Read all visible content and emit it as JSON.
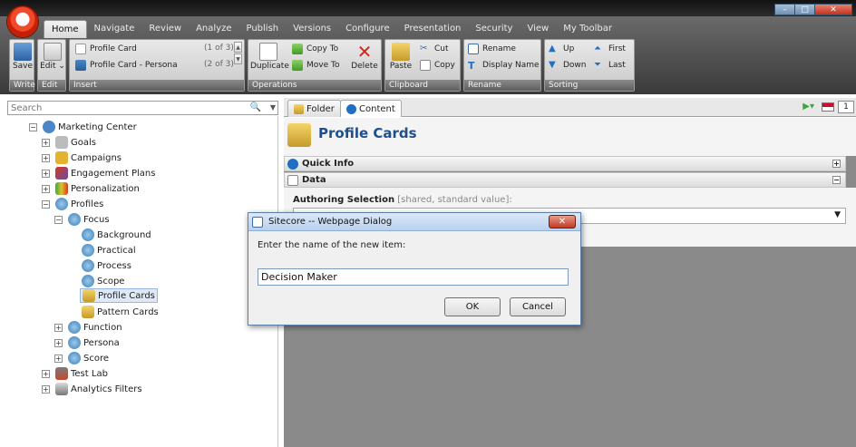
{
  "window": {
    "controls": [
      "–",
      "□",
      "✕"
    ]
  },
  "ribbon_tabs": [
    "Home",
    "Navigate",
    "Review",
    "Analyze",
    "Publish",
    "Versions",
    "Configure",
    "Presentation",
    "Security",
    "View",
    "My Toolbar"
  ],
  "ribbon": {
    "write": {
      "save": "Save",
      "group": "Write"
    },
    "edit": {
      "edit": "Edit",
      "group": "Edit"
    },
    "insert": {
      "items": [
        {
          "label": "Profile Card",
          "count": "(1 of 3)"
        },
        {
          "label": "Profile Card - Persona",
          "count": "(2 of 3)"
        }
      ],
      "group": "Insert"
    },
    "operations": {
      "duplicate": "Duplicate",
      "copy_to": "Copy To",
      "move_to": "Move To",
      "delete": "Delete",
      "group": "Operations"
    },
    "clipboard": {
      "paste": "Paste",
      "cut": "Cut",
      "copy": "Copy",
      "group": "Clipboard"
    },
    "rename": {
      "rename": "Rename",
      "display_name": "Display Name",
      "group": "Rename"
    },
    "sorting": {
      "up": "Up",
      "down": "Down",
      "first": "First",
      "last": "Last",
      "group": "Sorting"
    }
  },
  "search": {
    "placeholder": "Search"
  },
  "tree": {
    "root": "Marketing Center",
    "goals": "Goals",
    "campaigns": "Campaigns",
    "engagement": "Engagement Plans",
    "personalization": "Personalization",
    "profiles": "Profiles",
    "focus": "Focus",
    "background": "Background",
    "practical": "Practical",
    "process": "Process",
    "scope": "Scope",
    "profile_cards": "Profile Cards",
    "pattern_cards": "Pattern Cards",
    "function": "Function",
    "persona": "Persona",
    "score": "Score",
    "test_lab": "Test Lab",
    "analytics_filters": "Analytics Filters"
  },
  "content_tabs": {
    "folder": "Folder",
    "content": "Content",
    "toolbar_num": "1"
  },
  "content": {
    "title": "Profile Cards",
    "quick_info": "Quick Info",
    "data": "Data",
    "field_label": "Authoring Selection",
    "field_note": "[shared, standard value]:"
  },
  "dialog": {
    "title": "Sitecore -- Webpage Dialog",
    "prompt": "Enter the name of the new item:",
    "value": "Decision Maker",
    "ok": "OK",
    "cancel": "Cancel"
  },
  "colors": {
    "accent": "#1f6fc4",
    "orb": "#e03a1e",
    "dialog_title": "#c7dcf3",
    "gray_workspace": "#8a8a8a"
  }
}
